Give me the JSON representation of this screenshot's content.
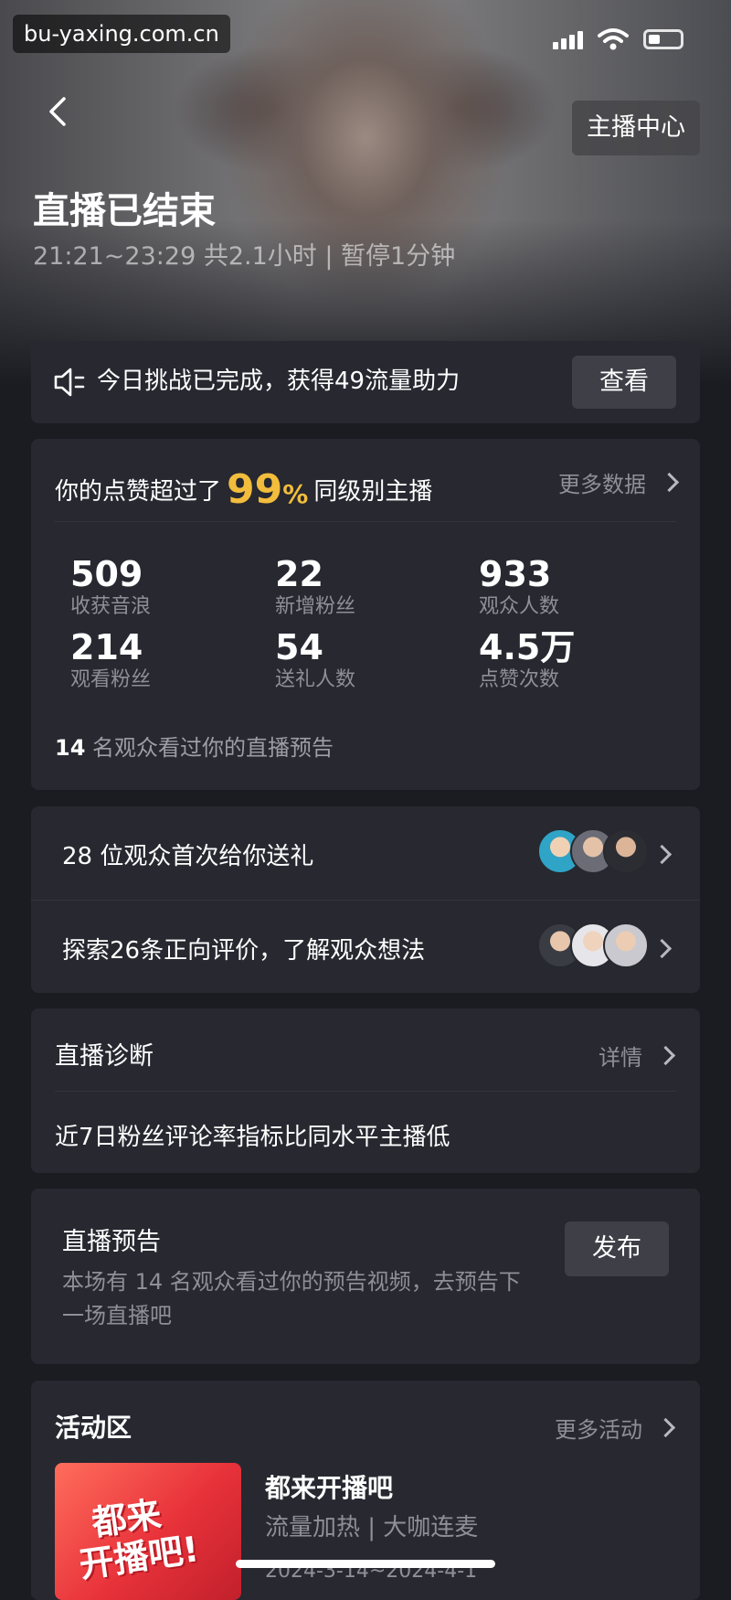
{
  "watermark": "bu-yaxing.com.cn",
  "header": {
    "center_button": "主播中心",
    "title": "直播已结束",
    "subtitle": "21:21~23:29 共2.1小时 | 暂停1分钟"
  },
  "challenge": {
    "text": "今日挑战已完成，获得49流量助力",
    "button": "查看"
  },
  "stats": {
    "lead_before": "你的点赞超过了",
    "percent": "99",
    "percent_sign": "%",
    "lead_after": "同级别主播",
    "more": "更多数据",
    "metrics": [
      {
        "value": "509",
        "label": "收获音浪"
      },
      {
        "value": "22",
        "label": "新增粉丝"
      },
      {
        "value": "933",
        "label": "观众人数"
      },
      {
        "value": "214",
        "label": "观看粉丝"
      },
      {
        "value": "54",
        "label": "送礼人数"
      },
      {
        "value": "4.5万",
        "label": "点赞次数"
      }
    ],
    "footer_count": "14",
    "footer_text": "名观众看过你的直播预告"
  },
  "social": {
    "gift_text": "28 位观众首次给你送礼",
    "review_text": "探索26条正向评价，了解观众想法"
  },
  "diagnosis": {
    "title": "直播诊断",
    "more": "详情",
    "text": "近7日粉丝评论率指标比同水平主播低"
  },
  "preview": {
    "title": "直播预告",
    "desc": "本场有 14 名观众看过你的预告视频，去预告下一场直播吧",
    "button": "发布"
  },
  "activity": {
    "title": "活动区",
    "more": "更多活动",
    "poster_line1": "都来",
    "poster_line2": "开播吧!",
    "item_title": "都来开播吧",
    "item_tags": "流量加热 | 大咖连麦",
    "item_dates": "2024-3-14~2024-4-1"
  },
  "colors": {
    "accent": "#f2bd3c",
    "background": "#1b1c22",
    "card": "#272830"
  }
}
